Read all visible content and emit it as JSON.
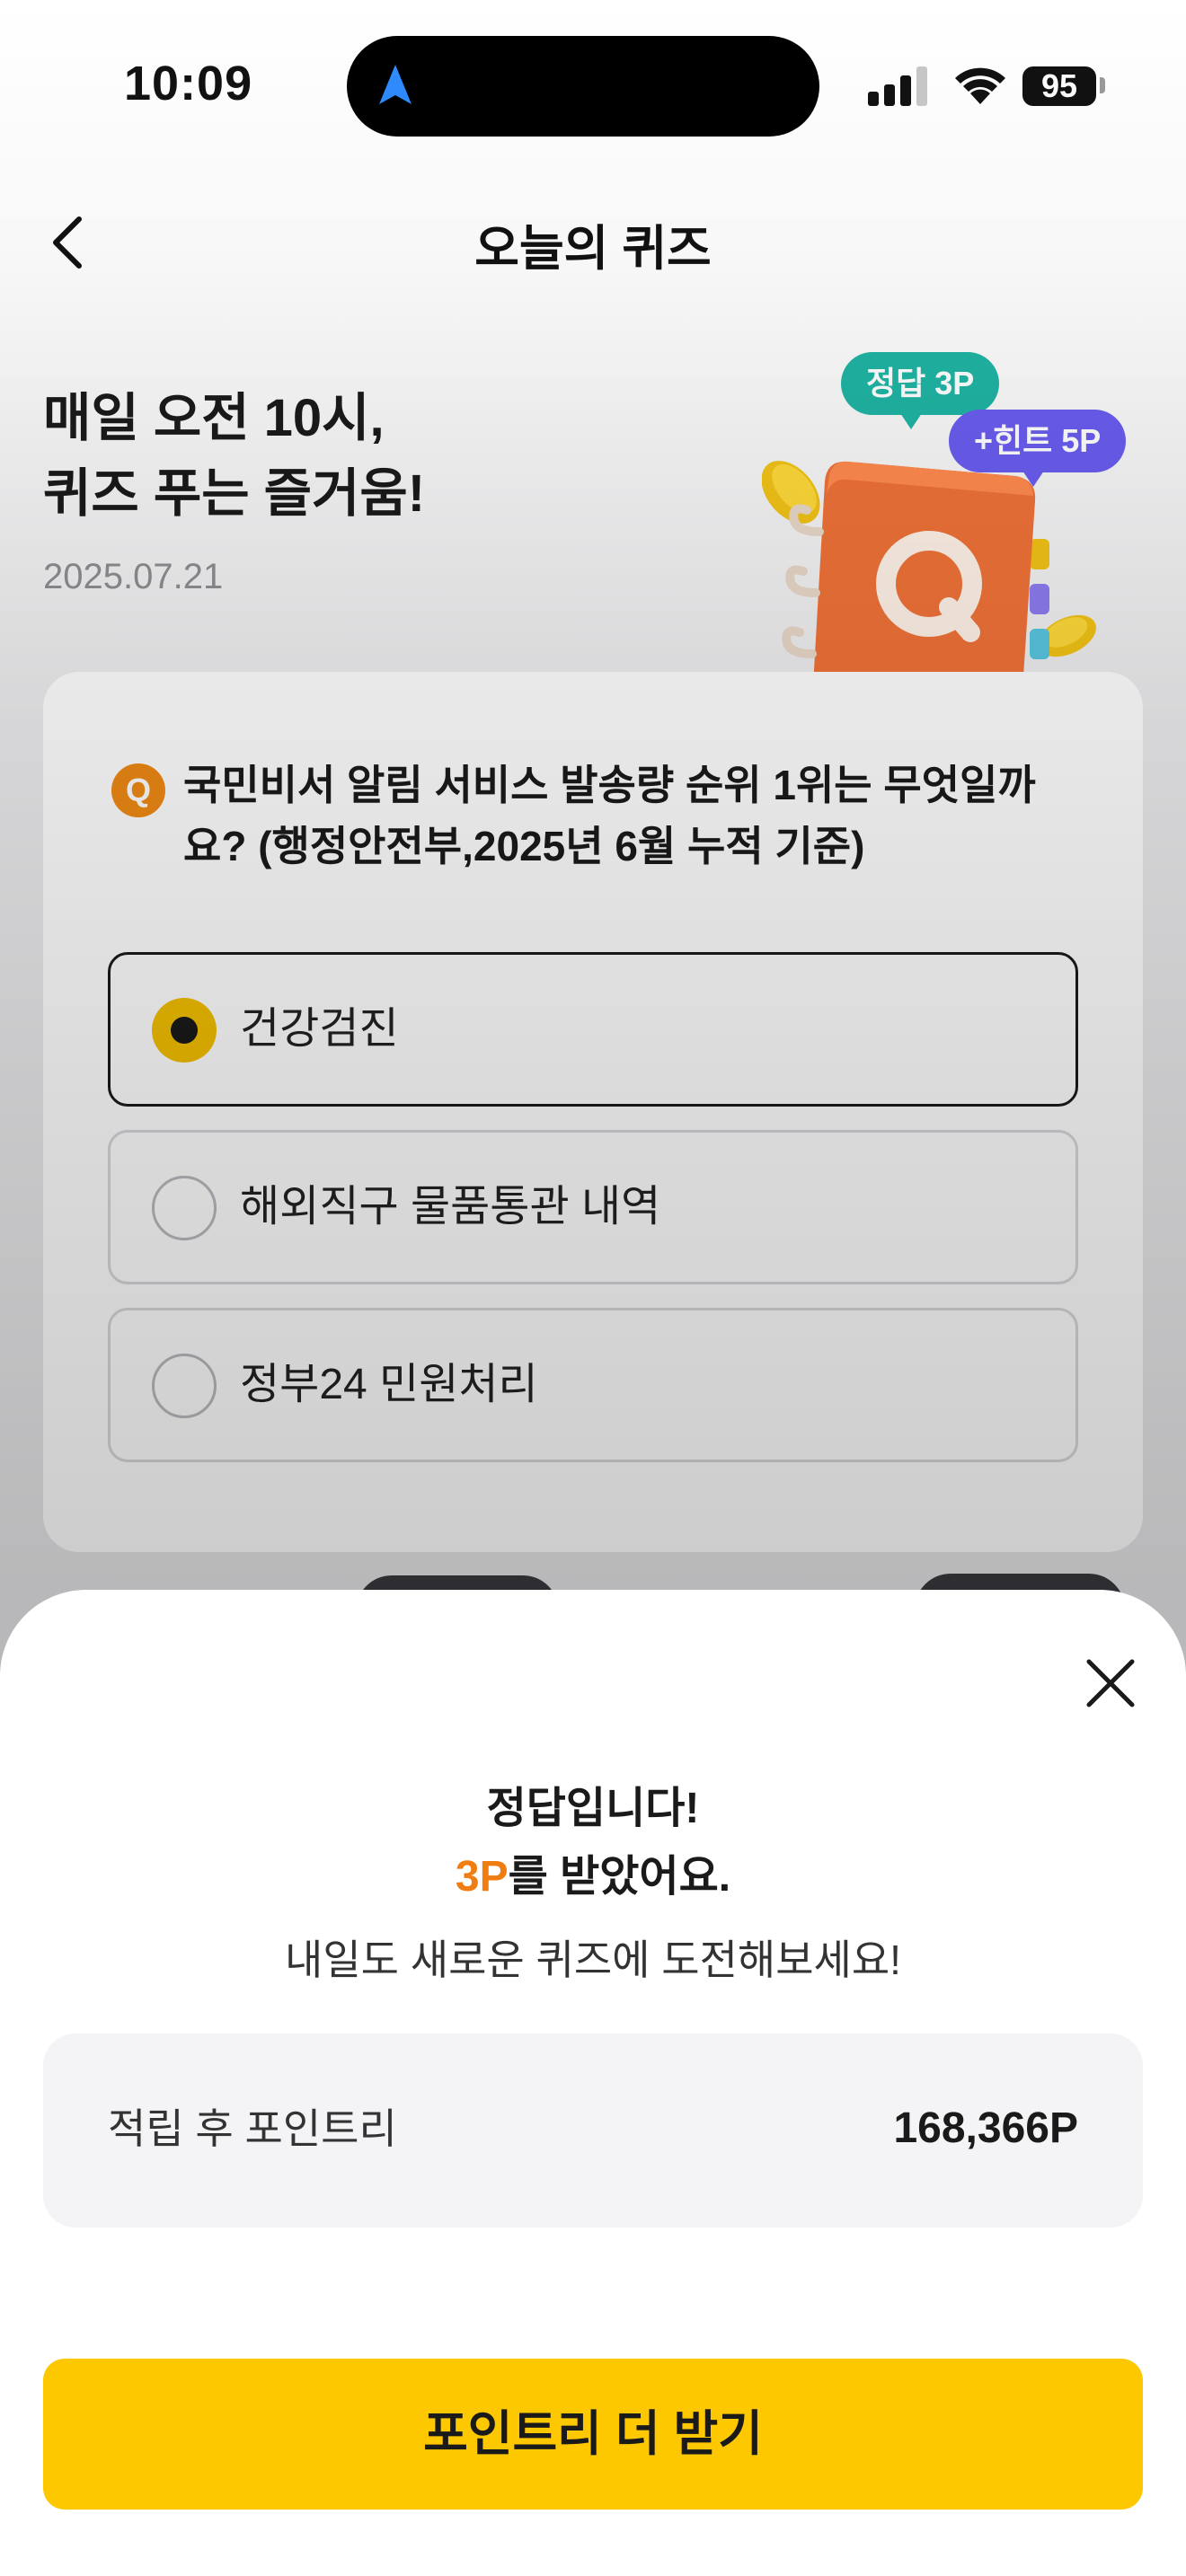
{
  "status_bar": {
    "time": "10:09",
    "battery": "95"
  },
  "header": {
    "title": "오늘의 퀴즈"
  },
  "hero": {
    "title_line1": "매일 오전 10시,",
    "title_line2": "퀴즈 푸는 즐거움!",
    "date": "2025.07.21",
    "bubble_answer": "정답 3P",
    "bubble_hint": "+힌트 5P"
  },
  "quiz": {
    "q_badge": "Q",
    "question": "국민비서 알림 서비스 발송량 순위 1위는 무엇일까요? (행정안전부,2025년 6월 누적 기준)",
    "options": [
      {
        "label": "건강검진",
        "selected": true
      },
      {
        "label": "해외직구 물품통관 내역",
        "selected": false
      },
      {
        "label": "정부24 민원처리",
        "selected": false
      }
    ]
  },
  "sheet": {
    "title_line1": "정답입니다!",
    "title_points": "3P",
    "title_line2_suffix": "를 받았어요.",
    "subtitle": "내일도 새로운 퀴즈에 도전해보세요!",
    "points_label": "적립 후 포인트리",
    "points_value": "168,366P",
    "cta_label": "포인트리 더 받기"
  },
  "colors": {
    "accent_yellow": "#fdc800",
    "accent_orange": "#f07d12",
    "bubble_teal": "#1fb4a4",
    "bubble_purple": "#6a5df0"
  }
}
